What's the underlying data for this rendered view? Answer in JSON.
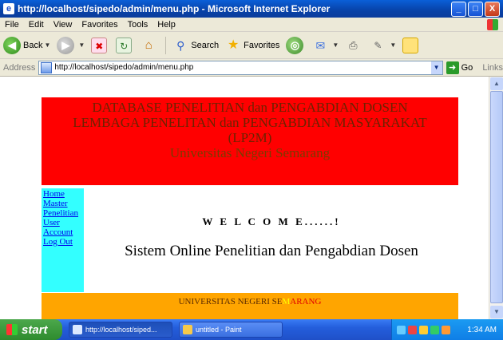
{
  "window": {
    "title": "http://localhost/sipedo/admin/menu.php - Microsoft Internet Explorer",
    "controls": {
      "minimize": "_",
      "maximize": "□",
      "close": "X"
    }
  },
  "menubar": [
    "File",
    "Edit",
    "View",
    "Favorites",
    "Tools",
    "Help"
  ],
  "toolbar": {
    "back_label": "Back",
    "search_label": "Search",
    "favorites_label": "Favorites"
  },
  "address": {
    "label": "Address",
    "value": "http://localhost/sipedo/admin/menu.php",
    "go_label": "Go",
    "links_label": "Links"
  },
  "page": {
    "header": {
      "line1": "DATABASE PENELITIAN dan PENGABDIAN DOSEN",
      "line2": "LEMBAGA PENELITAN dan PENGABDIAN MASYARAKAT",
      "line3": "(LP2M)",
      "line4": "Universitas Negeri Semarang"
    },
    "menu": [
      "Home",
      "Master",
      "Penelitian",
      "User",
      "Account",
      "Log Out"
    ],
    "welcome": "W E L C O M E......!",
    "subtitle": "Sistem Online Penelitian dan Pengabdian Dosen",
    "footer": {
      "part1": "UNIVERSITAS NEGERI SE",
      "part2": "M",
      "part3": "ARANG"
    }
  },
  "taskbar": {
    "start_label": "start",
    "tasks": [
      "http://localhost/siped...",
      "untitled - Paint"
    ],
    "clock": "1:34 AM"
  },
  "colors": {
    "header_bg": "#ff0000",
    "menu_bg": "#33ffff",
    "footer_bg": "#ffa500",
    "titlebar": "#0842a8"
  }
}
